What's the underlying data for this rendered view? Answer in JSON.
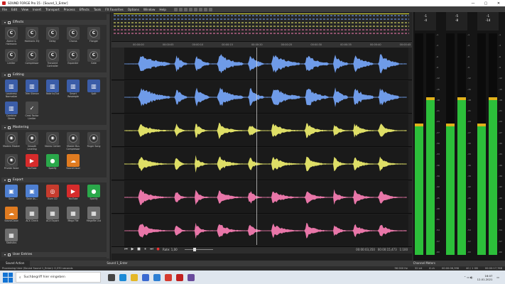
{
  "window": {
    "title": "SOUND FORGE Pro 15 - [Sound_1_Enter]",
    "minimize": "—",
    "maximize": "▢",
    "close": "✕"
  },
  "menu": [
    "File",
    "Edit",
    "View",
    "Insert",
    "Transport",
    "Process",
    "Effects",
    "Tools",
    "FX Favorites",
    "Options",
    "Window",
    "Help"
  ],
  "left_panel": {
    "sections": [
      {
        "title": "Effects",
        "tiles": [
          {
            "label": "Alpine & Harmonic",
            "glyph": "C"
          },
          {
            "label": "Harmonic EQ",
            "glyph": "C"
          },
          {
            "label": "Delay",
            "glyph": "C"
          },
          {
            "label": "Chorus",
            "glyph": "C"
          },
          {
            "label": "Flanger",
            "glyph": "C"
          },
          {
            "label": "Limiter",
            "glyph": "C"
          },
          {
            "label": "Compressor",
            "glyph": "C"
          },
          {
            "label": "Transient Controller",
            "glyph": "C"
          },
          {
            "label": "Expander",
            "glyph": "C"
          },
          {
            "label": "Gate",
            "glyph": "C"
          }
        ]
      },
      {
        "title": "Editing",
        "tiles": [
          {
            "label": "Loudness Normalize",
            "glyph": "▥"
          },
          {
            "label": "Trim Silence",
            "glyph": "▥"
          },
          {
            "label": "Fade In/Out",
            "glyph": "▥"
          },
          {
            "label": "Smart Resample",
            "glyph": "▥"
          },
          {
            "label": "Split",
            "glyph": "▥"
          },
          {
            "label": "Combine Stereo",
            "glyph": "▥"
          },
          {
            "label": "Crest Factor Limiter",
            "glyph": "✓"
          }
        ]
      },
      {
        "title": "Mastering",
        "tiles": [
          {
            "label": "Modern Master",
            "glyph": "◉"
          },
          {
            "label": "Smooth Leveling",
            "glyph": "◉"
          },
          {
            "label": "Stereo Center",
            "glyph": "◉"
          },
          {
            "label": "Master Bus Compressor",
            "glyph": "◉"
          },
          {
            "label": "Finger Song",
            "glyph": "◉"
          },
          {
            "label": "Private Voice",
            "glyph": "◉"
          },
          {
            "label": "YouTube",
            "glyph": "▶"
          },
          {
            "label": "Spotify",
            "glyph": "●"
          },
          {
            "label": "SoundCloud",
            "glyph": "☁"
          }
        ]
      },
      {
        "title": "Export",
        "tiles": [
          {
            "label": "Save",
            "glyph": "▣"
          },
          {
            "label": "Save As...",
            "glyph": "▣"
          },
          {
            "label": "Burn CD",
            "glyph": "◎"
          },
          {
            "label": "YouTube",
            "glyph": "▶"
          },
          {
            "label": "Spotify",
            "glyph": "●"
          },
          {
            "label": "SoundCloud",
            "glyph": "☁"
          },
          {
            "label": "ACX Check",
            "glyph": "▦"
          },
          {
            "label": "ACX Export",
            "glyph": "▦"
          },
          {
            "label": "Mega File",
            "glyph": "▦"
          },
          {
            "label": "Megafile List",
            "glyph": "▦"
          },
          {
            "label": "Statistics",
            "glyph": "▦"
          }
        ]
      },
      {
        "title": "User Entries",
        "tiles": [
          {
            "label": "Preserve",
            "glyph": "FX"
          },
          {
            "label": "Mixdown",
            "glyph": "FX"
          },
          {
            "label": "Create New Entry",
            "glyph": "✚"
          }
        ]
      }
    ]
  },
  "ruler": [
    "00:00:00",
    "00:00:05",
    "00:00:10",
    "00:00:15",
    "00:00:20",
    "00:00:25",
    "00:00:30",
    "00:00:35",
    "00:00:40",
    "00:00:45",
    "00:00:50",
    "00:00:55"
  ],
  "transport": {
    "rate_label": "Rate: 1,00",
    "position": "00:00:03,350",
    "selection": "00:00:15,473",
    "length": "1:100"
  },
  "tracks": [
    {
      "color": "#6f9be8"
    },
    {
      "color": "#6f9be8"
    },
    {
      "color": "#dede66"
    },
    {
      "color": "#dede66"
    },
    {
      "color": "#e876a8"
    },
    {
      "color": "#e876a8"
    }
  ],
  "meters": {
    "heads": [
      {
        "peak": "-1",
        "rms": "-4"
      },
      {
        "peak": "-5",
        "rms": "-8"
      },
      {
        "peak": "-1",
        "rms": "-14"
      }
    ],
    "levels": [
      0.58,
      0.7,
      0.58,
      0.7,
      0.58,
      0.7
    ],
    "scale": [
      "-1",
      "-3",
      "-6",
      "-9",
      "-12",
      "-15",
      "-18",
      "-21",
      "-24",
      "-27",
      "-30",
      "-33",
      "-36",
      "-39",
      "-42",
      "-45",
      "-48",
      "-51",
      "-54",
      "-57",
      "-60"
    ]
  },
  "tabs": {
    "left": "Sound Action",
    "main": "Sound 1_Enter",
    "right": "Channel Meters"
  },
  "status": {
    "left": "Processing time (Sound Sound 1_Enter): 0,370 seconds",
    "rate": "96 000 Hz",
    "bit": "32 bit",
    "channels": "6 ch",
    "length": "00:00:06,398",
    "size": "40 / 1 GB",
    "free": "00:00:17,768"
  },
  "taskbar": {
    "search_placeholder": "Suchbegriff hier eingeben",
    "time": "16:07",
    "date": "12.01.2021"
  }
}
